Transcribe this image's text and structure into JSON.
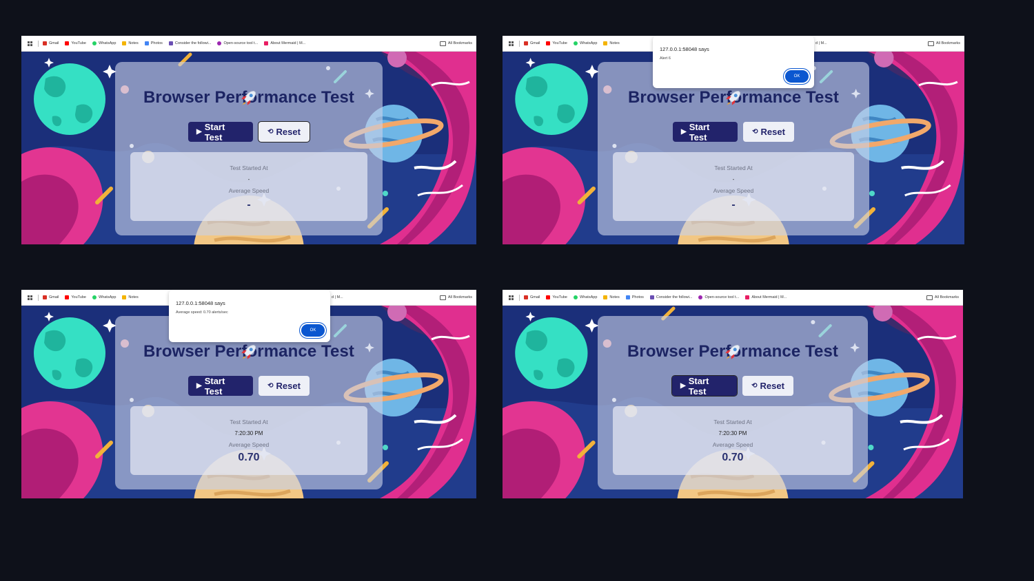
{
  "bookmarks": {
    "items": [
      {
        "label": "Gmail",
        "color": "#d93025"
      },
      {
        "label": "YouTube",
        "color": "#ff0000"
      },
      {
        "label": "WhatsApp",
        "color": "#25d366"
      },
      {
        "label": "Notes",
        "color": "#f4b400"
      },
      {
        "label": "Photos",
        "color": "#4285f4"
      },
      {
        "label": "Consider the followi...",
        "color": "#6a4fb3"
      },
      {
        "label": "Open-source tool t...",
        "color": "#9c27b0"
      },
      {
        "label": "About Mermaid | M...",
        "color": "#e91e63"
      }
    ],
    "all_label": "All Bookmarks",
    "truncated_tail": "d | M..."
  },
  "app": {
    "title": "Browser Performance Test",
    "start_label": "Start Test",
    "reset_label": "Reset",
    "started_label": "Test Started At",
    "speed_label": "Average Speed"
  },
  "shots": [
    {
      "started_value": "-",
      "speed_value": "-"
    },
    {
      "started_value": "-",
      "speed_value": "-",
      "dialog": {
        "title": "127.0.0.1:58048 says",
        "message": "Alert 6",
        "ok": "OK"
      }
    },
    {
      "started_value": "7:20:30 PM",
      "speed_value": "0.70",
      "dialog": {
        "title": "127.0.0.1:58048 says",
        "message": "Average speed: 0.70 alerts/sec",
        "ok": "OK"
      }
    },
    {
      "started_value": "7:20:30 PM",
      "speed_value": "0.70"
    }
  ],
  "colors": {
    "accent": "#22236b",
    "ok_button": "#0b57d0"
  }
}
